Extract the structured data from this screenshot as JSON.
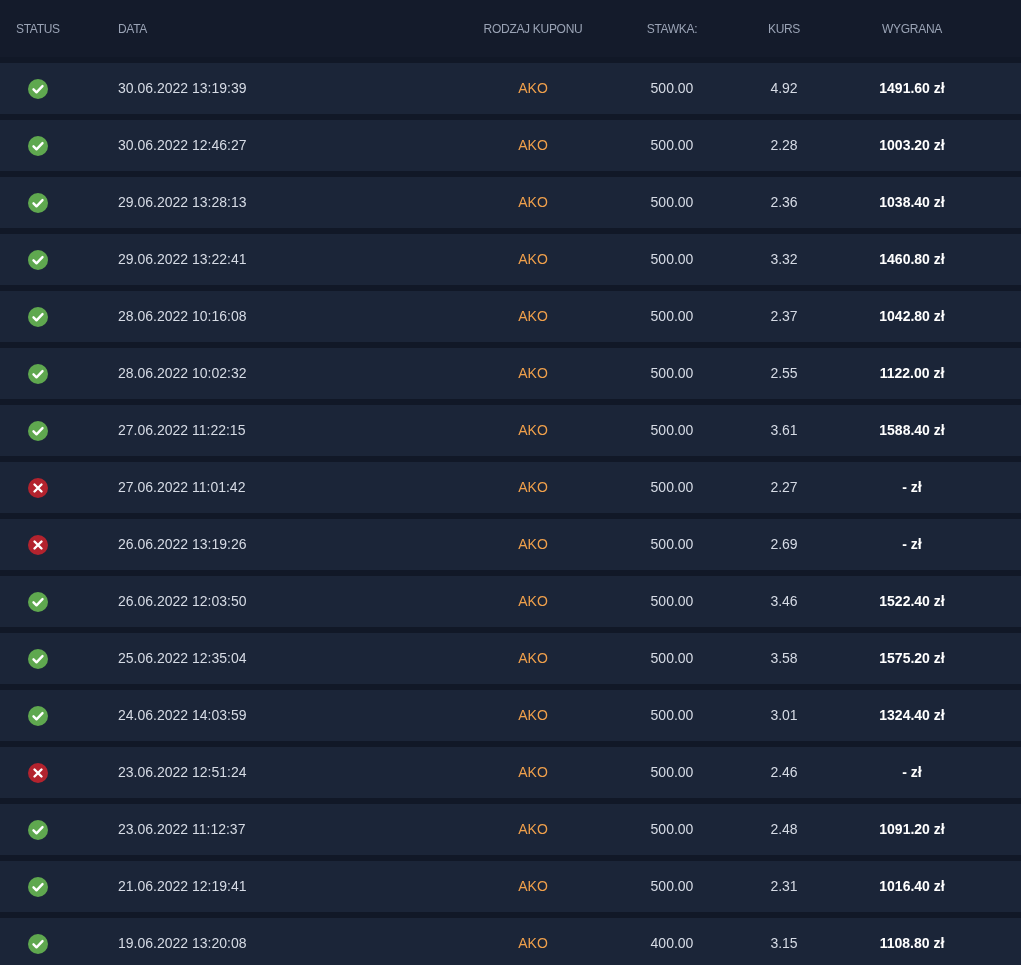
{
  "table": {
    "columns": [
      "STATUS",
      "DATA",
      "RODZAJ KUPONU",
      "STAWKA:",
      "KURS",
      "WYGRANA"
    ],
    "rows": [
      {
        "won": true,
        "date": "30.06.2022 13:19:39",
        "type": "AKO",
        "stake": "500.00",
        "odds": "4.92",
        "win": "1491.60 zł"
      },
      {
        "won": true,
        "date": "30.06.2022 12:46:27",
        "type": "AKO",
        "stake": "500.00",
        "odds": "2.28",
        "win": "1003.20 zł"
      },
      {
        "won": true,
        "date": "29.06.2022 13:28:13",
        "type": "AKO",
        "stake": "500.00",
        "odds": "2.36",
        "win": "1038.40 zł"
      },
      {
        "won": true,
        "date": "29.06.2022 13:22:41",
        "type": "AKO",
        "stake": "500.00",
        "odds": "3.32",
        "win": "1460.80 zł"
      },
      {
        "won": true,
        "date": "28.06.2022 10:16:08",
        "type": "AKO",
        "stake": "500.00",
        "odds": "2.37",
        "win": "1042.80 zł"
      },
      {
        "won": true,
        "date": "28.06.2022 10:02:32",
        "type": "AKO",
        "stake": "500.00",
        "odds": "2.55",
        "win": "1122.00 zł"
      },
      {
        "won": true,
        "date": "27.06.2022 11:22:15",
        "type": "AKO",
        "stake": "500.00",
        "odds": "3.61",
        "win": "1588.40 zł"
      },
      {
        "won": false,
        "date": "27.06.2022 11:01:42",
        "type": "AKO",
        "stake": "500.00",
        "odds": "2.27",
        "win": "- zł"
      },
      {
        "won": false,
        "date": "26.06.2022 13:19:26",
        "type": "AKO",
        "stake": "500.00",
        "odds": "2.69",
        "win": "- zł"
      },
      {
        "won": true,
        "date": "26.06.2022 12:03:50",
        "type": "AKO",
        "stake": "500.00",
        "odds": "3.46",
        "win": "1522.40 zł"
      },
      {
        "won": true,
        "date": "25.06.2022 12:35:04",
        "type": "AKO",
        "stake": "500.00",
        "odds": "3.58",
        "win": "1575.20 zł"
      },
      {
        "won": true,
        "date": "24.06.2022 14:03:59",
        "type": "AKO",
        "stake": "500.00",
        "odds": "3.01",
        "win": "1324.40 zł"
      },
      {
        "won": false,
        "date": "23.06.2022 12:51:24",
        "type": "AKO",
        "stake": "500.00",
        "odds": "2.46",
        "win": "- zł"
      },
      {
        "won": true,
        "date": "23.06.2022 11:12:37",
        "type": "AKO",
        "stake": "500.00",
        "odds": "2.48",
        "win": "1091.20 zł"
      },
      {
        "won": true,
        "date": "21.06.2022 12:19:41",
        "type": "AKO",
        "stake": "500.00",
        "odds": "2.31",
        "win": "1016.40 zł"
      },
      {
        "won": true,
        "date": "19.06.2022 13:20:08",
        "type": "AKO",
        "stake": "400.00",
        "odds": "3.15",
        "win": "1108.80 zł"
      }
    ]
  }
}
